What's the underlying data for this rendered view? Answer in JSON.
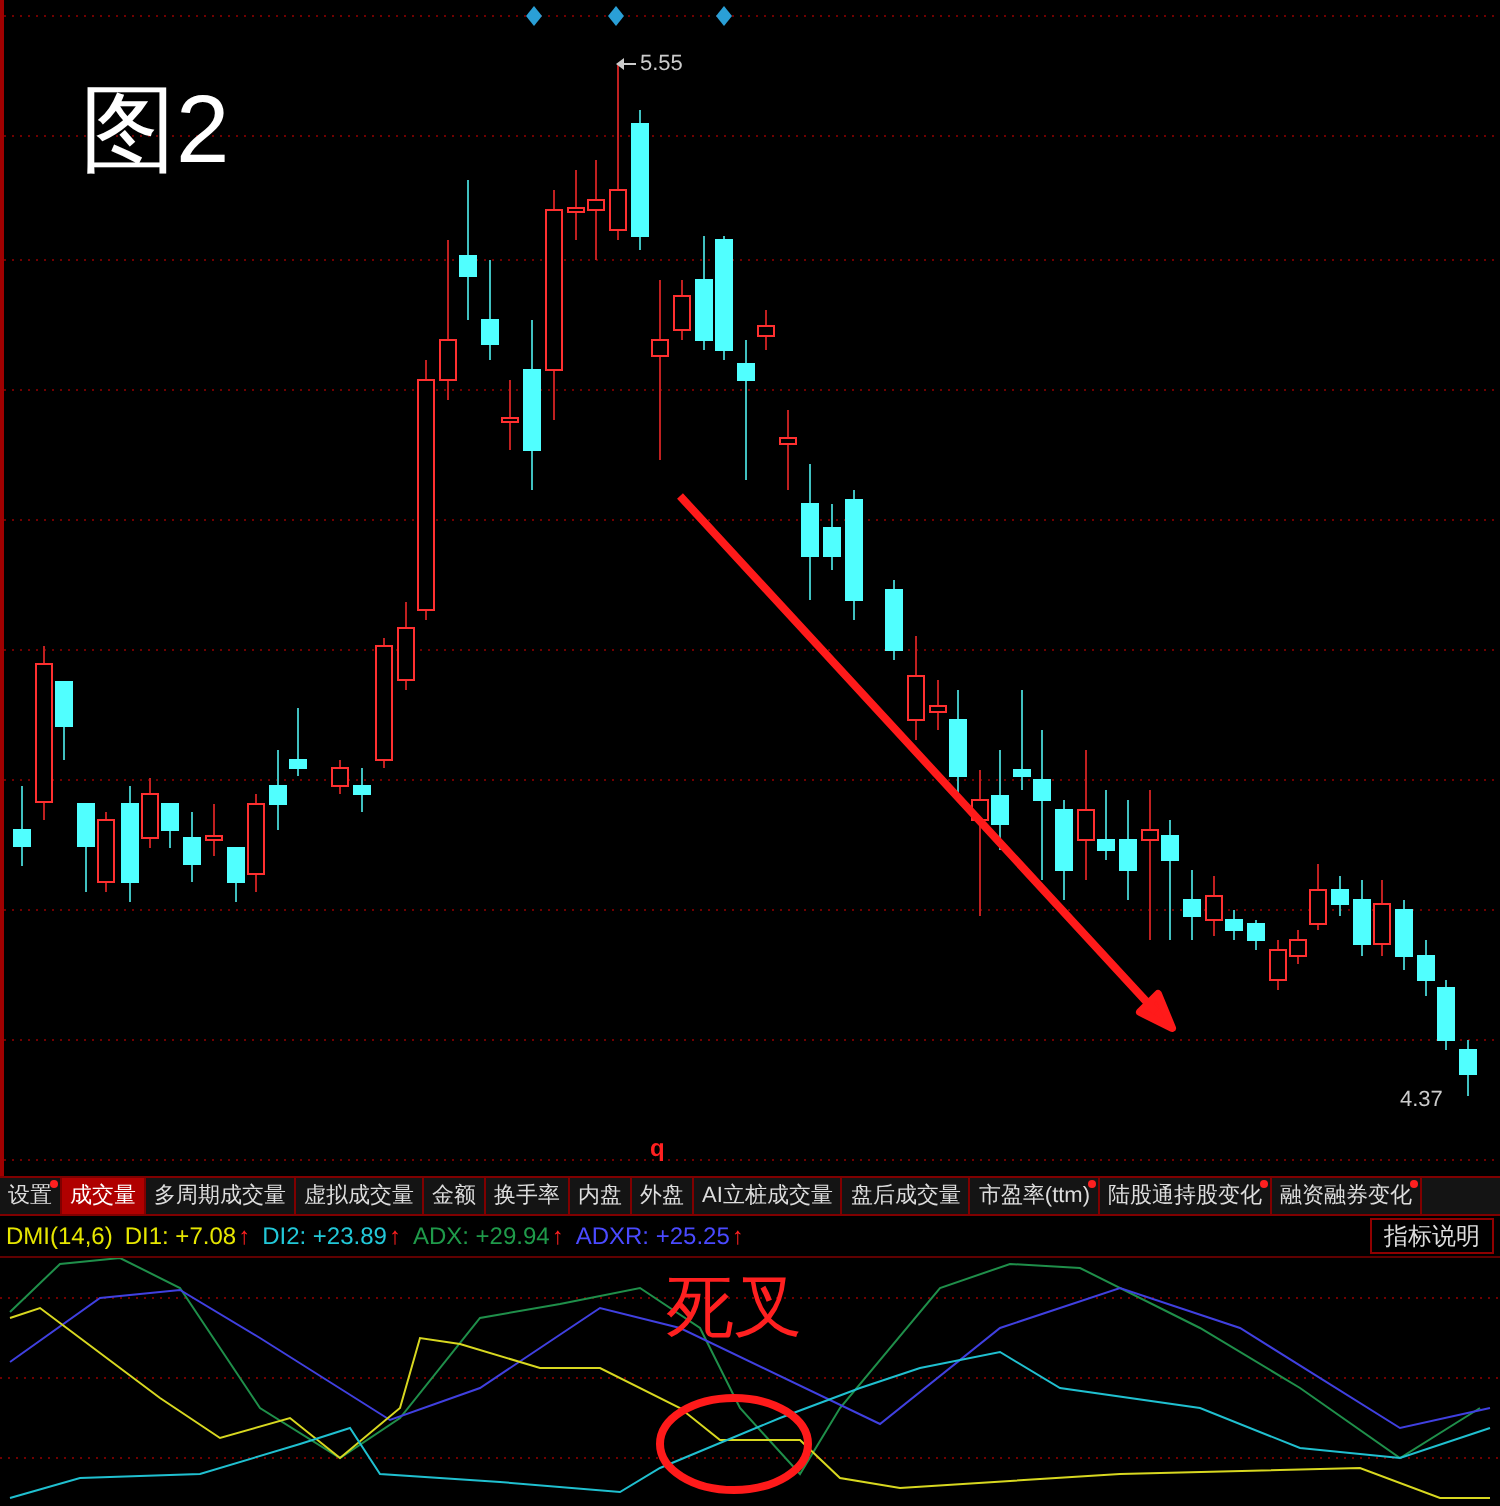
{
  "chart": {
    "label": "图2",
    "high_label": "5.55",
    "low_label": "4.37",
    "marker": "q"
  },
  "tabs": [
    {
      "label": "设置",
      "selected": false,
      "dot": true
    },
    {
      "label": "成交量",
      "selected": true,
      "dot": false
    },
    {
      "label": "多周期成交量",
      "selected": false,
      "dot": false
    },
    {
      "label": "虚拟成交量",
      "selected": false,
      "dot": false
    },
    {
      "label": "金额",
      "selected": false,
      "dot": false
    },
    {
      "label": "换手率",
      "selected": false,
      "dot": false
    },
    {
      "label": "内盘",
      "selected": false,
      "dot": false
    },
    {
      "label": "外盘",
      "selected": false,
      "dot": false
    },
    {
      "label": "AI立桩成交量",
      "selected": false,
      "dot": false
    },
    {
      "label": "盘后成交量",
      "selected": false,
      "dot": false
    },
    {
      "label": "市盈率(ttm)",
      "selected": false,
      "dot": true
    },
    {
      "label": "陆股通持股变化",
      "selected": false,
      "dot": true
    },
    {
      "label": "融资融券变化",
      "selected": false,
      "dot": true
    }
  ],
  "indicator": {
    "name": "DMI(14,6)",
    "values": [
      {
        "label": "DI1: +7.08",
        "color": "#e6e600",
        "arrow": "↑"
      },
      {
        "label": "DI2: +23.89",
        "color": "#22c8d8",
        "arrow": "↑"
      },
      {
        "label": "ADX: +29.94",
        "color": "#1f9a4a",
        "arrow": "↑"
      },
      {
        "label": "ADXR: +25.25",
        "color": "#4a4aff",
        "arrow": "↑"
      }
    ],
    "help_button": "指标说明"
  },
  "annotation": {
    "text": "死叉"
  }
}
